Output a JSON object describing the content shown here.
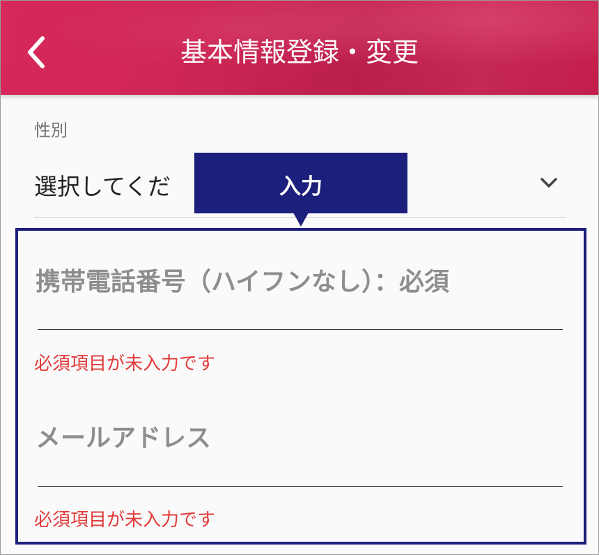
{
  "header": {
    "title": "基本情報登録・変更",
    "back_icon": "chevron-left-icon",
    "background_color": "#d0285a"
  },
  "form": {
    "gender": {
      "label": "性別",
      "selected_value": "選択してくだ",
      "icon": "chevron-down-icon"
    },
    "phone": {
      "label": "携帯電話番号（ハイフンなし）：必須",
      "value": "",
      "error": "必須項目が未入力です"
    },
    "email": {
      "label": "メールアドレス",
      "value": "",
      "error": "必須項目が未入力です"
    }
  },
  "annotation": {
    "tooltip_text": "入力",
    "highlight_color": "#1d1f7c"
  },
  "colors": {
    "error": "#e23b3b",
    "label": "#8e8e8e"
  }
}
